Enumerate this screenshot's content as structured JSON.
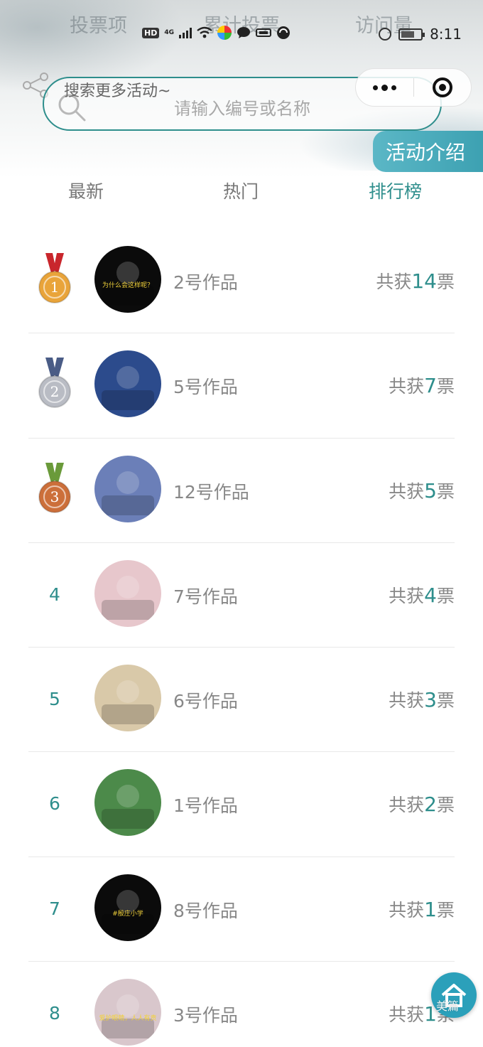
{
  "header": {
    "faded_stats": [
      "投票项",
      "累计投票",
      "访问量"
    ],
    "nav_title": "搜索更多活动~",
    "intro_button": "活动介绍"
  },
  "status_bar": {
    "left_labels": [
      "HD",
      "4G"
    ],
    "time": "8:11"
  },
  "search": {
    "placeholder": "请输入编号或名称",
    "value": ""
  },
  "tabs": [
    {
      "label": "最新",
      "active": false
    },
    {
      "label": "热门",
      "active": false
    },
    {
      "label": "排行榜",
      "active": true
    }
  ],
  "ranking": [
    {
      "rank": "1",
      "medal": "gold",
      "name": "2号作品",
      "prefix": "共获",
      "count": "14",
      "suffix": "票",
      "avatar_color": "#0b0b0b",
      "avatar_text": "为什么会这样呢？"
    },
    {
      "rank": "2",
      "medal": "silver",
      "name": "5号作品",
      "prefix": "共获",
      "count": "7",
      "suffix": "票",
      "avatar_color": "#2c4b8c",
      "avatar_text": ""
    },
    {
      "rank": "3",
      "medal": "bronze",
      "name": "12号作品",
      "prefix": "共获",
      "count": "5",
      "suffix": "票",
      "avatar_color": "#6b7fb8",
      "avatar_text": ""
    },
    {
      "rank": "4",
      "medal": "",
      "name": "7号作品",
      "prefix": "共获",
      "count": "4",
      "suffix": "票",
      "avatar_color": "#e7c7cc",
      "avatar_text": ""
    },
    {
      "rank": "5",
      "medal": "",
      "name": "6号作品",
      "prefix": "共获",
      "count": "3",
      "suffix": "票",
      "avatar_color": "#d9c9a9",
      "avatar_text": ""
    },
    {
      "rank": "6",
      "medal": "",
      "name": "1号作品",
      "prefix": "共获",
      "count": "2",
      "suffix": "票",
      "avatar_color": "#4c8a4a",
      "avatar_text": ""
    },
    {
      "rank": "7",
      "medal": "",
      "name": "8号作品",
      "prefix": "共获",
      "count": "1",
      "suffix": "票",
      "avatar_color": "#0b0b0b",
      "avatar_text": "#殷庄小学"
    },
    {
      "rank": "8",
      "medal": "",
      "name": "3号作品",
      "prefix": "共获",
      "count": "1",
      "suffix": "票",
      "avatar_color": "#d9c7cc",
      "avatar_text": "爱护眼睛，人人有责"
    }
  ],
  "fab": {
    "watermark": "美篇"
  },
  "colors": {
    "accent": "#2e8e8c",
    "gold": "#e9a43a",
    "silver": "#b9bcc4",
    "bronze": "#cc6f3a",
    "fab": "#2ba0ba"
  }
}
